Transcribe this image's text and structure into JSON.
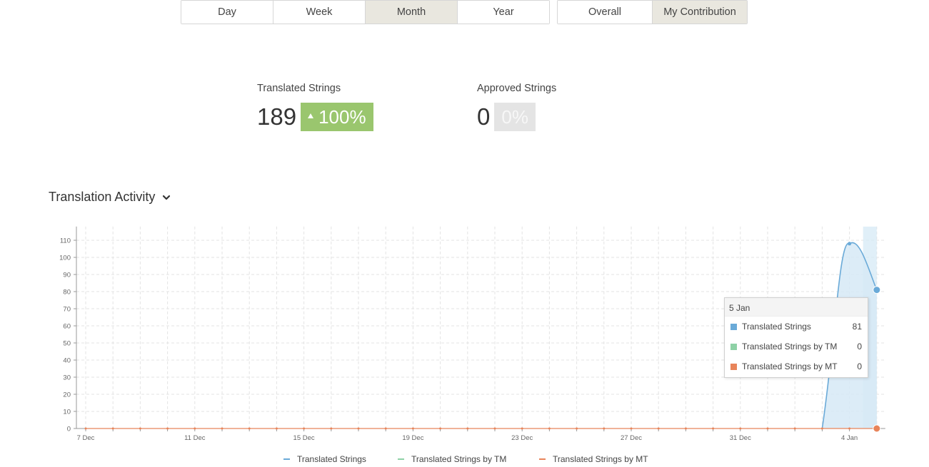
{
  "period_tabs": [
    {
      "label": "Day",
      "active": false
    },
    {
      "label": "Week",
      "active": false
    },
    {
      "label": "Month",
      "active": true
    },
    {
      "label": "Year",
      "active": false
    }
  ],
  "scope_tabs": [
    {
      "label": "Overall",
      "active": false
    },
    {
      "label": "My Contribution",
      "active": true
    }
  ],
  "stats": {
    "translated": {
      "label": "Translated Strings",
      "value": "189",
      "change": "100%"
    },
    "approved": {
      "label": "Approved Strings",
      "value": "0",
      "change": "0%"
    }
  },
  "section": {
    "title": "Translation Activity",
    "icon": "chevron-down-icon"
  },
  "colors": {
    "translated": "#6aaad8",
    "tm": "#8ed1a6",
    "mt": "#e8845a",
    "badge_up": "#9ac66e",
    "active_tab": "#e9e7df"
  },
  "chart_data": {
    "type": "area",
    "y_ticks": [
      "0",
      "10",
      "20",
      "30",
      "40",
      "50",
      "60",
      "70",
      "80",
      "90",
      "100",
      "110"
    ],
    "ylim": [
      0,
      118
    ],
    "x_ticks": [
      "7 Dec",
      "11 Dec",
      "15 Dec",
      "19 Dec",
      "23 Dec",
      "27 Dec",
      "31 Dec",
      "4 Jan"
    ],
    "x_start": "7 Dec",
    "x_end": "5 Jan",
    "series": [
      {
        "name": "Translated Strings",
        "values": [
          0,
          0,
          0,
          0,
          0,
          0,
          0,
          0,
          0,
          0,
          0,
          0,
          0,
          0,
          0,
          0,
          0,
          0,
          0,
          0,
          0,
          0,
          0,
          0,
          0,
          0,
          0,
          0,
          108,
          81
        ]
      },
      {
        "name": "Translated Strings by TM",
        "values": [
          0,
          0,
          0,
          0,
          0,
          0,
          0,
          0,
          0,
          0,
          0,
          0,
          0,
          0,
          0,
          0,
          0,
          0,
          0,
          0,
          0,
          0,
          0,
          0,
          0,
          0,
          0,
          0,
          0,
          0
        ]
      },
      {
        "name": "Translated Strings by MT",
        "values": [
          0,
          0,
          0,
          0,
          0,
          0,
          0,
          0,
          0,
          0,
          0,
          0,
          0,
          0,
          0,
          0,
          0,
          0,
          0,
          0,
          0,
          0,
          0,
          0,
          0,
          0,
          0,
          0,
          0,
          0
        ]
      }
    ],
    "grid": true,
    "legend": "bottom"
  },
  "tooltip": {
    "date": "5 Jan",
    "rows": [
      {
        "name": "Translated Strings",
        "value": "81"
      },
      {
        "name": "Translated Strings by TM",
        "value": "0"
      },
      {
        "name": "Translated Strings by MT",
        "value": "0"
      }
    ]
  }
}
